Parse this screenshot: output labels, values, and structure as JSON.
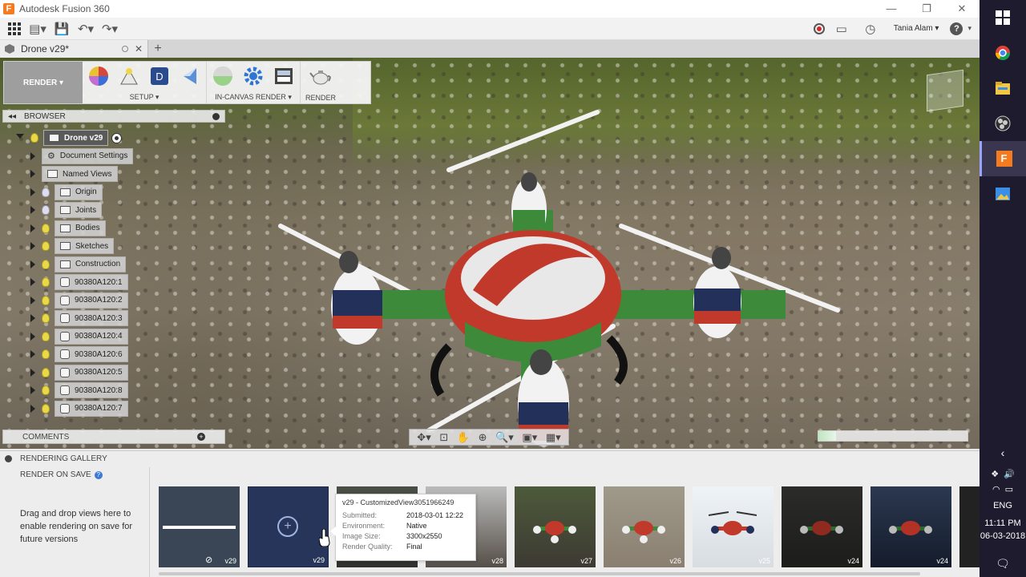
{
  "window": {
    "app_title": "Autodesk Fusion 360",
    "controls": [
      "—",
      "❐",
      "✕"
    ]
  },
  "qat": {
    "user_name": "Tania Alam",
    "help": "?"
  },
  "document_tab": {
    "name": "Drone v29*"
  },
  "ribbon": {
    "workspace": "RENDER ▾",
    "groups": [
      {
        "label": "SETUP ▾"
      },
      {
        "label": "IN-CANVAS RENDER ▾"
      },
      {
        "label": "RENDER"
      }
    ]
  },
  "browser": {
    "title": "BROWSER",
    "root": "Drone v29",
    "items": [
      {
        "label": "Document Settings",
        "icon": "gear-icon",
        "bulb": false
      },
      {
        "label": "Named Views",
        "icon": "folder-icon",
        "bulb": false
      },
      {
        "label": "Origin",
        "icon": "folder-icon",
        "bulb": "off"
      },
      {
        "label": "Joints",
        "icon": "folder-icon",
        "bulb": "off"
      },
      {
        "label": "Bodies",
        "icon": "folder-icon",
        "bulb": "on"
      },
      {
        "label": "Sketches",
        "icon": "folder-icon",
        "bulb": "on"
      },
      {
        "label": "Construction",
        "icon": "folder-icon",
        "bulb": "on"
      },
      {
        "label": "90380A120:1",
        "icon": "component-icon",
        "bulb": "on"
      },
      {
        "label": "90380A120:2",
        "icon": "component-icon",
        "bulb": "on"
      },
      {
        "label": "90380A120:3",
        "icon": "component-icon",
        "bulb": "on"
      },
      {
        "label": "90380A120:4",
        "icon": "component-icon",
        "bulb": "on"
      },
      {
        "label": "90380A120:6",
        "icon": "component-icon",
        "bulb": "on"
      },
      {
        "label": "90380A120:5",
        "icon": "component-icon",
        "bulb": "on"
      },
      {
        "label": "90380A120:8",
        "icon": "component-icon",
        "bulb": "on"
      },
      {
        "label": "90380A120:7",
        "icon": "component-icon",
        "bulb": "on"
      }
    ]
  },
  "comments": {
    "title": "COMMENTS"
  },
  "gallery": {
    "title": "RENDERING GALLERY",
    "render_on_save": "RENDER ON SAVE",
    "hint": "Drag and drop views here to enable rendering on save for future versions",
    "thumbs": [
      {
        "version": "v29"
      },
      {
        "version": "v29"
      },
      {
        "version": ""
      },
      {
        "version": "v28"
      },
      {
        "version": "v27"
      },
      {
        "version": "v26"
      },
      {
        "version": "v25"
      },
      {
        "version": "v24"
      },
      {
        "version": "v24"
      }
    ],
    "tooltip": {
      "title": "v29 - CustomizedView3051966249",
      "submitted_label": "Submitted:",
      "submitted": "2018-03-01 12:22",
      "environment_label": "Environment:",
      "environment": "Native",
      "size_label": "Image Size:",
      "size": "3300x2550",
      "quality_label": "Render Quality:",
      "quality": "Final"
    }
  },
  "taskbar": {
    "time": "11:11 PM",
    "date": "06-03-2018",
    "lang": "ENG"
  },
  "progress": {
    "fraction": 0.12
  },
  "colors": {
    "accent_orange": "#f47b20",
    "drone_green": "#3d8a3a",
    "drone_red": "#c0392b",
    "drone_navy": "#23305a"
  }
}
